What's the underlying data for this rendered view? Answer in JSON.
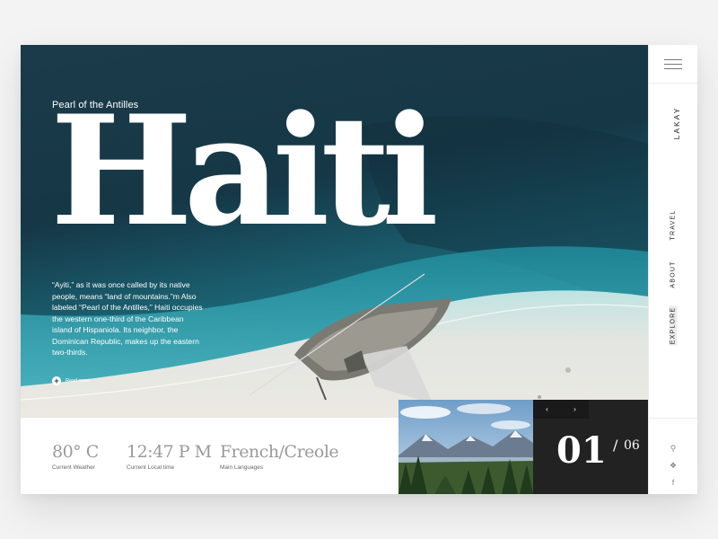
{
  "hero": {
    "subtitle": "Pearl of the Antilles",
    "title": "Haiti",
    "description": "“Ayiti,” as it was once called by its native people, means “land of mountains.”m Also labeled “Pearl of the Antilles,” Haiti occupies the western one-third of the Caribbean island of Hispaniola. Its neighbor, the Dominican Republic, makes up the eastern two-thirds.",
    "read_more": "Read more"
  },
  "nav": {
    "brand": "LAKAY",
    "items": [
      "TRAVEL",
      "ABOUT",
      "EXPLORE"
    ],
    "active": "EXPLORE"
  },
  "stats": [
    {
      "value": "80° C",
      "label": "Current Weather"
    },
    {
      "value": "12:47 P M",
      "label": "Current Local time"
    },
    {
      "value": "French/Creole",
      "label": "Main Languages"
    }
  ],
  "slider": {
    "current": "01",
    "separator": "/",
    "total": "06",
    "prev_icon": "chevron-left-icon",
    "next_icon": "chevron-right-icon"
  },
  "social": [
    "pinterest-icon",
    "twitter-icon",
    "facebook-icon"
  ],
  "colors": {
    "page_bg": "#f3f3f3",
    "card_bg": "#ffffff",
    "counter_bg": "#222222",
    "stat_text": "#9a9a9a"
  }
}
